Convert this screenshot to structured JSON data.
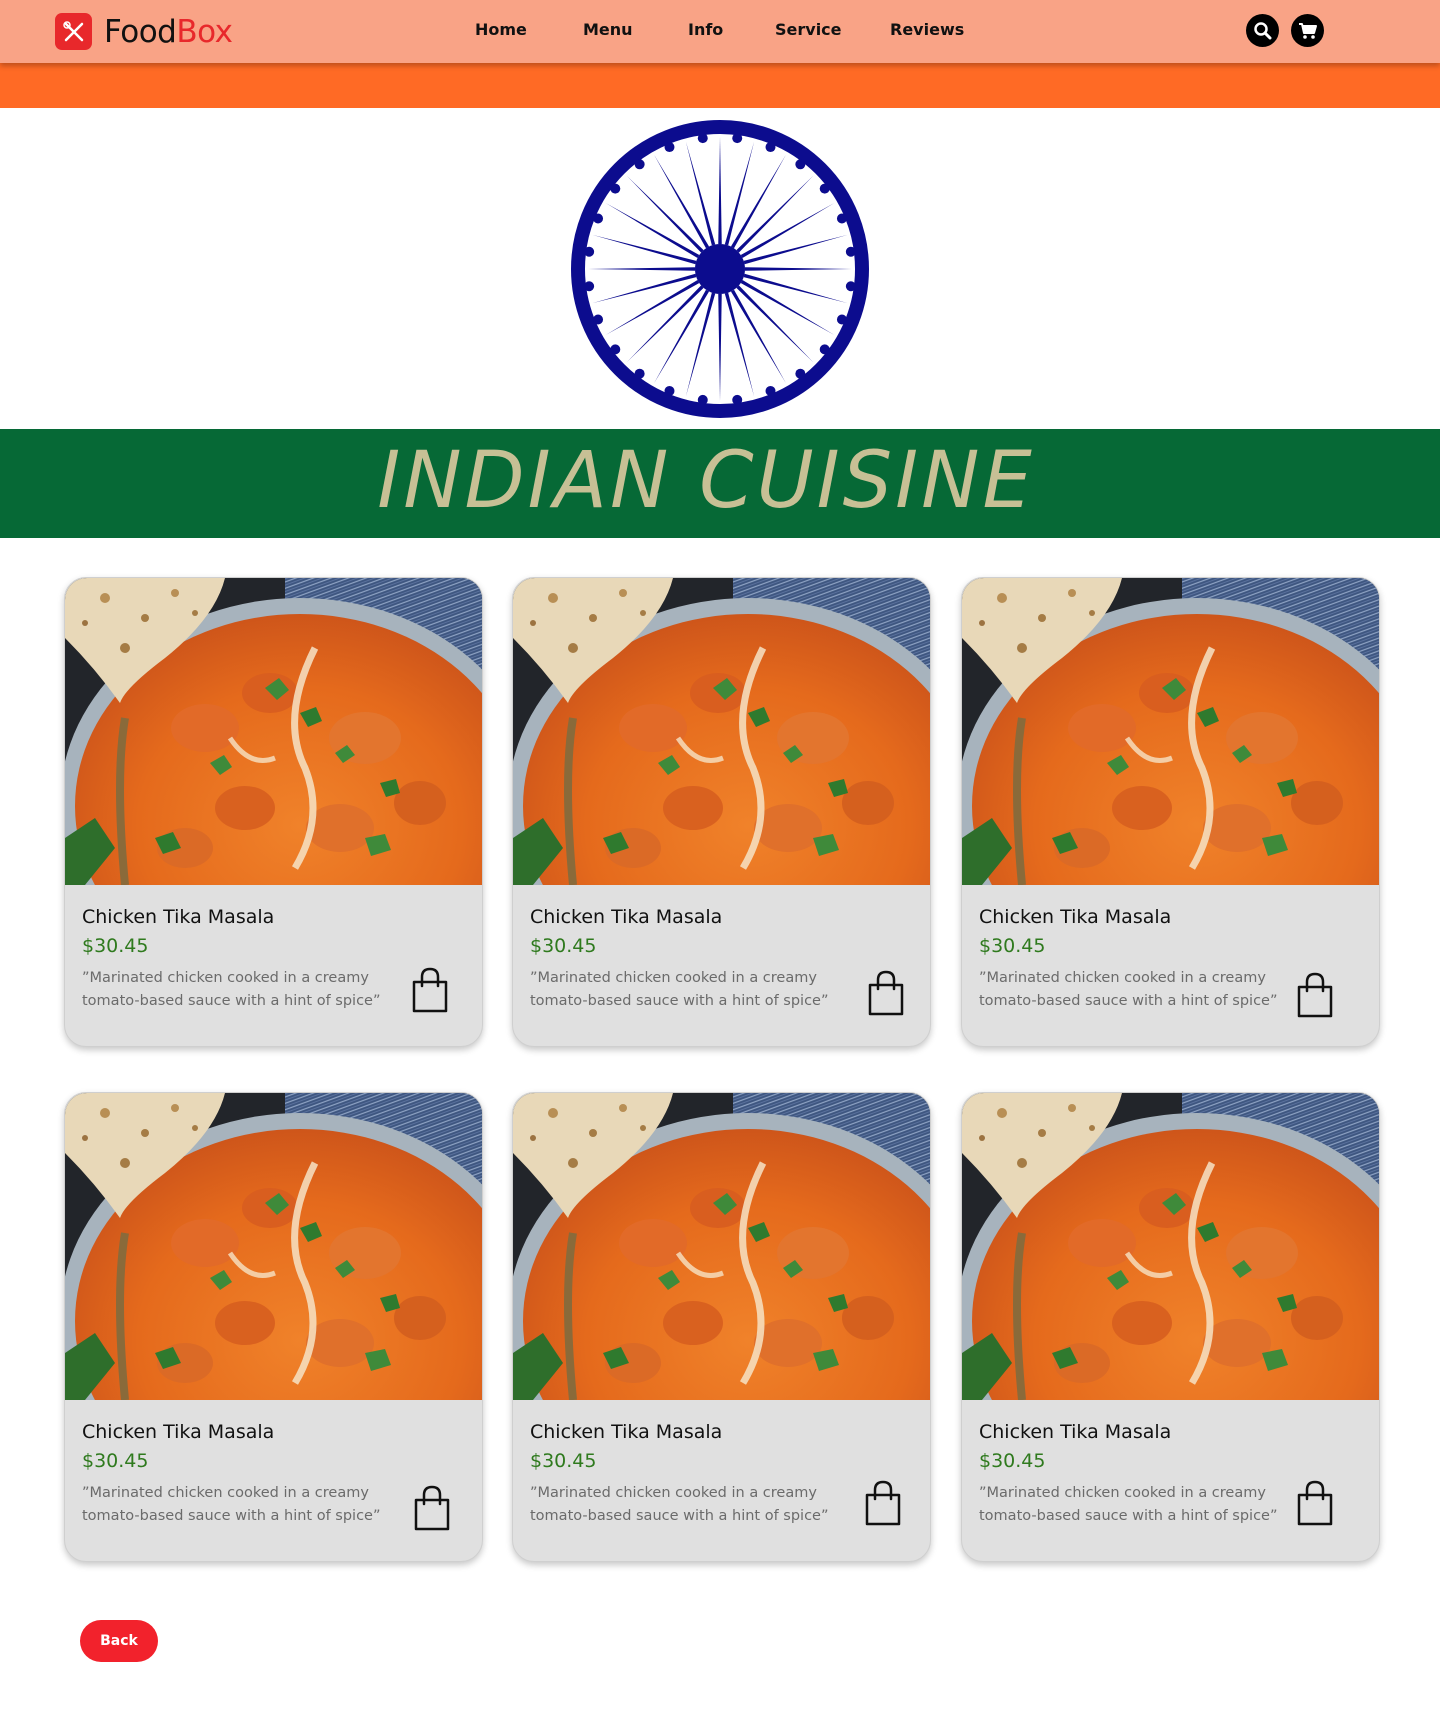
{
  "brand": {
    "name_part1": "Food",
    "name_part2": "Box"
  },
  "nav": {
    "home": "Home",
    "menu": "Menu",
    "info": "Info",
    "service": "Service",
    "reviews": "Reviews"
  },
  "banner": {
    "title": "INDIAN CUISINE"
  },
  "colors": {
    "header": "#F9A386",
    "saffron": "#FF6A25",
    "green": "#066936",
    "chakra": "#0C0C8E",
    "accent_red": "#F2222C",
    "price_green": "#2F7A1E"
  },
  "icons": {
    "search": "search-icon",
    "cart": "cart-icon",
    "bag": "shopping-bag-icon",
    "logo": "fork-knife-icon",
    "chakra": "ashoka-chakra-icon"
  },
  "cards": [
    {
      "name": "Chicken Tika Masala",
      "price": "$30.45",
      "description": "”Marinated chicken cooked in a creamy tomato-based sauce with a hint of spice”"
    },
    {
      "name": "Chicken Tika Masala",
      "price": "$30.45",
      "description": "”Marinated chicken cooked in a creamy tomato-based sauce with a hint of spice”"
    },
    {
      "name": "Chicken Tika Masala",
      "price": "$30.45",
      "description": "”Marinated chicken cooked in a creamy tomato-based sauce with a hint of spice”"
    },
    {
      "name": "Chicken Tika Masala",
      "price": "$30.45",
      "description": "”Marinated chicken cooked in a creamy tomato-based sauce with a hint of spice”"
    },
    {
      "name": "Chicken Tika Masala",
      "price": "$30.45",
      "description": "”Marinated chicken cooked in a creamy tomato-based sauce with a hint of spice”"
    },
    {
      "name": "Chicken Tika Masala",
      "price": "$30.45",
      "description": "”Marinated chicken cooked in a creamy tomato-based sauce with a hint of spice”"
    }
  ],
  "back_button": {
    "label": "Back"
  }
}
